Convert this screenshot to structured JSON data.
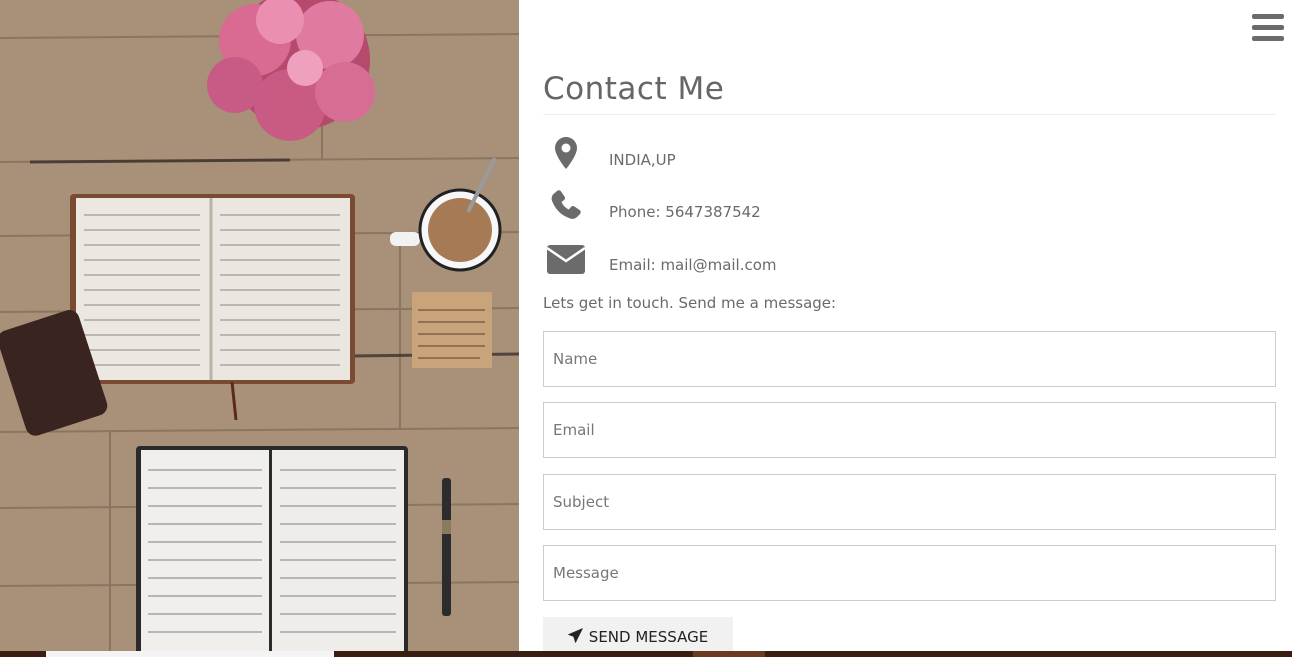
{
  "header": {
    "title": "Contact Me",
    "menu_icon": "hamburger-menu-icon"
  },
  "contact_info": [
    {
      "icon": "map-marker-icon",
      "text": "INDIA,UP"
    },
    {
      "icon": "phone-icon",
      "text": "Phone: 5647387542"
    },
    {
      "icon": "envelope-icon",
      "text": "Email: mail@mail.com"
    }
  ],
  "form": {
    "intro": "Lets get in touch. Send me a message:",
    "name_placeholder": "Name",
    "email_placeholder": "Email",
    "subject_placeholder": "Subject",
    "message_placeholder": "Message",
    "submit_label": "SEND MESSAGE",
    "submit_icon": "paper-plane-icon"
  },
  "colors": {
    "text": "#666666",
    "icon": "#6b6b6b",
    "button_bg": "#f1f1f1",
    "input_border": "#cccccc"
  }
}
